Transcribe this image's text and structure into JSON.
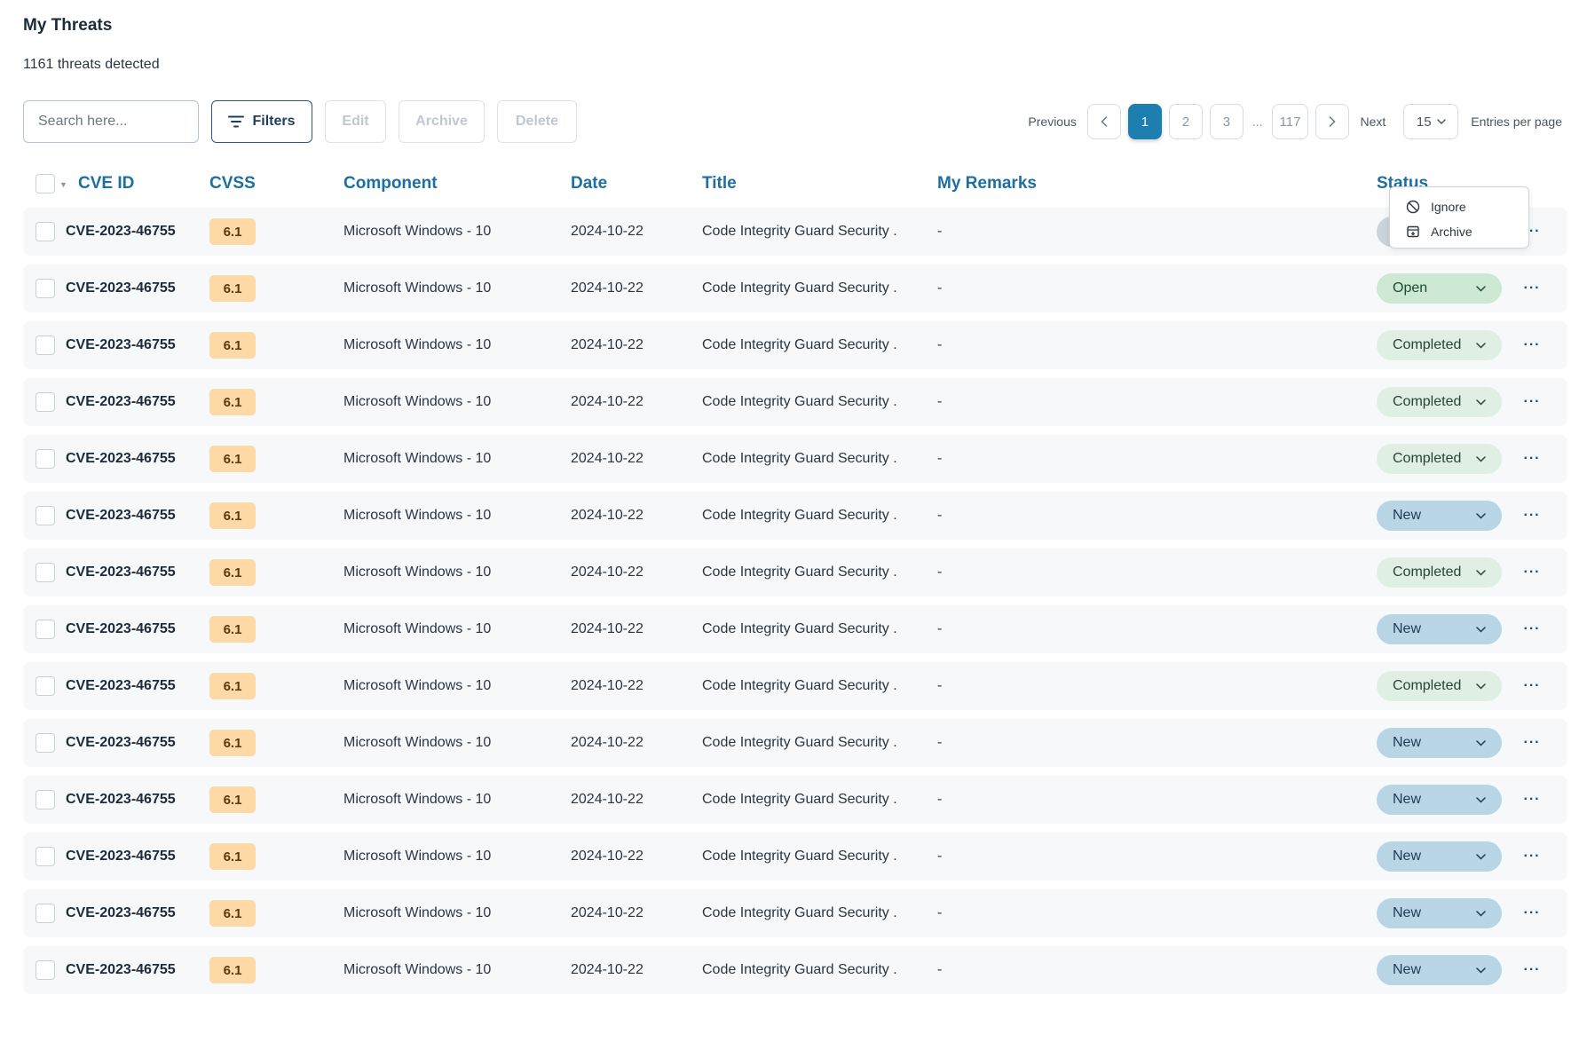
{
  "header": {
    "title": "My Threats",
    "subtitle": "1161 threats detected"
  },
  "toolbar": {
    "search_placeholder": "Search here...",
    "filters_label": "Filters",
    "edit_label": "Edit",
    "archive_label": "Archive",
    "delete_label": "Delete"
  },
  "pagination": {
    "previous_label": "Previous",
    "next_label": "Next",
    "pages": [
      "1",
      "2",
      "3",
      "117"
    ],
    "current_page": "1",
    "ellipsis": "...",
    "per_page_value": "15",
    "per_page_label": "Entries per page"
  },
  "table": {
    "columns": [
      "CVE ID",
      "CVSS",
      "Component",
      "Date",
      "Title",
      "My Remarks",
      "Status"
    ],
    "rows": [
      {
        "cve": "CVE-2023-46755",
        "cvss": "6.1",
        "component": "Microsoft Windows - 10",
        "date": "2024-10-22",
        "title": "Code Integrity Guard Security .",
        "remarks": "-",
        "status": "",
        "status_kind": "gray"
      },
      {
        "cve": "CVE-2023-46755",
        "cvss": "6.1",
        "component": "Microsoft Windows - 10",
        "date": "2024-10-22",
        "title": "Code Integrity Guard Security .",
        "remarks": "-",
        "status": "Open",
        "status_kind": "open"
      },
      {
        "cve": "CVE-2023-46755",
        "cvss": "6.1",
        "component": "Microsoft Windows - 10",
        "date": "2024-10-22",
        "title": "Code Integrity Guard Security .",
        "remarks": "-",
        "status": "Completed",
        "status_kind": "completed"
      },
      {
        "cve": "CVE-2023-46755",
        "cvss": "6.1",
        "component": "Microsoft Windows - 10",
        "date": "2024-10-22",
        "title": "Code Integrity Guard Security .",
        "remarks": "-",
        "status": "Completed",
        "status_kind": "completed"
      },
      {
        "cve": "CVE-2023-46755",
        "cvss": "6.1",
        "component": "Microsoft Windows - 10",
        "date": "2024-10-22",
        "title": "Code Integrity Guard Security .",
        "remarks": "-",
        "status": "Completed",
        "status_kind": "completed"
      },
      {
        "cve": "CVE-2023-46755",
        "cvss": "6.1",
        "component": "Microsoft Windows - 10",
        "date": "2024-10-22",
        "title": "Code Integrity Guard Security .",
        "remarks": "-",
        "status": "New",
        "status_kind": "new"
      },
      {
        "cve": "CVE-2023-46755",
        "cvss": "6.1",
        "component": "Microsoft Windows - 10",
        "date": "2024-10-22",
        "title": "Code Integrity Guard Security .",
        "remarks": "-",
        "status": "Completed",
        "status_kind": "completed"
      },
      {
        "cve": "CVE-2023-46755",
        "cvss": "6.1",
        "component": "Microsoft Windows - 10",
        "date": "2024-10-22",
        "title": "Code Integrity Guard Security .",
        "remarks": "-",
        "status": "New",
        "status_kind": "new"
      },
      {
        "cve": "CVE-2023-46755",
        "cvss": "6.1",
        "component": "Microsoft Windows - 10",
        "date": "2024-10-22",
        "title": "Code Integrity Guard Security .",
        "remarks": "-",
        "status": "Completed",
        "status_kind": "completed"
      },
      {
        "cve": "CVE-2023-46755",
        "cvss": "6.1",
        "component": "Microsoft Windows - 10",
        "date": "2024-10-22",
        "title": "Code Integrity Guard Security .",
        "remarks": "-",
        "status": "New",
        "status_kind": "new"
      },
      {
        "cve": "CVE-2023-46755",
        "cvss": "6.1",
        "component": "Microsoft Windows - 10",
        "date": "2024-10-22",
        "title": "Code Integrity Guard Security .",
        "remarks": "-",
        "status": "New",
        "status_kind": "new"
      },
      {
        "cve": "CVE-2023-46755",
        "cvss": "6.1",
        "component": "Microsoft Windows - 10",
        "date": "2024-10-22",
        "title": "Code Integrity Guard Security .",
        "remarks": "-",
        "status": "New",
        "status_kind": "new"
      },
      {
        "cve": "CVE-2023-46755",
        "cvss": "6.1",
        "component": "Microsoft Windows - 10",
        "date": "2024-10-22",
        "title": "Code Integrity Guard Security .",
        "remarks": "-",
        "status": "New",
        "status_kind": "new"
      },
      {
        "cve": "CVE-2023-46755",
        "cvss": "6.1",
        "component": "Microsoft Windows - 10",
        "date": "2024-10-22",
        "title": "Code Integrity Guard Security .",
        "remarks": "-",
        "status": "New",
        "status_kind": "new"
      }
    ]
  },
  "context_menu": {
    "items": [
      {
        "label": "Ignore",
        "icon": "ban-icon"
      },
      {
        "label": "Archive",
        "icon": "archive-icon"
      }
    ]
  },
  "colors": {
    "accent": "#1d7fb0",
    "header_text": "#1d6fa3",
    "cvss_badge": "#fdd9a6",
    "status_open": "#cde8d3",
    "status_completed": "#e0efe3",
    "status_new": "#b8d6e6"
  }
}
